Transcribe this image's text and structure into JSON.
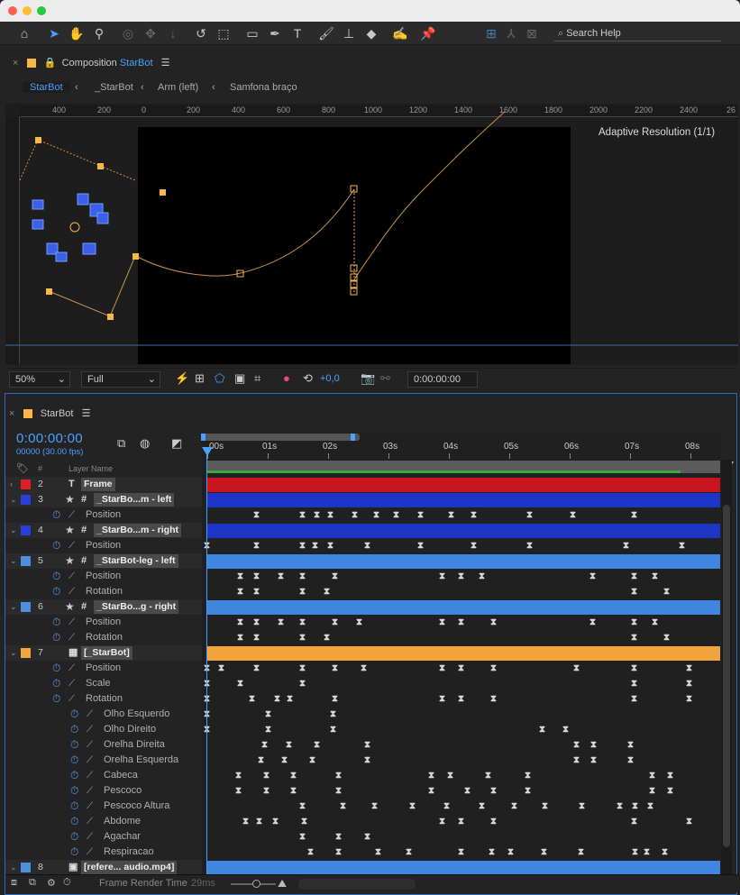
{
  "toolbar": {
    "search_placeholder": "Search Help",
    "tools": [
      "home-icon",
      "selection-icon",
      "hand-icon",
      "zoom-icon",
      "orbit-icon",
      "pan-icon",
      "dolly-icon",
      "rotate-icon",
      "region-icon",
      "rectangle-icon",
      "pen-icon",
      "type-icon",
      "brush-icon",
      "clone-icon",
      "eraser-icon",
      "roto-icon",
      "puppet-icon"
    ]
  },
  "composition_panel": {
    "tab_prefix": "Composition",
    "comp_name": "StarBot",
    "breadcrumbs": [
      "StarBot",
      "_StarBot",
      "Arm (left)",
      "Samfona braço"
    ],
    "ruler_labels": [
      "400",
      "200",
      "0",
      "200",
      "400",
      "600",
      "800",
      "1000",
      "1200",
      "1400",
      "1600",
      "1800",
      "2000",
      "2200",
      "2400",
      "26"
    ],
    "adaptive_resolution": "Adaptive Resolution (1/1)",
    "zoom": "50%",
    "resolution": "Full",
    "exposure": "+0,0",
    "current_time": "0:00:00:00"
  },
  "timeline": {
    "comp_name": "StarBot",
    "timecode": "0:00:00:00",
    "frame_info": "00000 (30.00 fps)",
    "layer_name_header": "Layer Name",
    "hash_header": "#",
    "time_ticks": [
      "00s",
      "01s",
      "02s",
      "03s",
      "04s",
      "05s",
      "06s",
      "07s",
      "08s"
    ],
    "frame_render_time_label": "Frame Render Time",
    "frame_render_time_value": "29ms",
    "rows": [
      {
        "kind": "layer",
        "num": "2",
        "type": "T",
        "name": "Frame",
        "label_color": "#e02020",
        "bar_color": "#c8141c",
        "kf": []
      },
      {
        "kind": "layer",
        "num": "3",
        "type": "#",
        "name": "_StarBo...m - left",
        "label_color": "#2a3ed8",
        "bar_color": "#1e36c8",
        "kf": []
      },
      {
        "kind": "prop",
        "name": "Position",
        "icon": "graph",
        "indent": 1,
        "kf": [
          285,
          336,
          352,
          367,
          394,
          418,
          440,
          467,
          501,
          526,
          588,
          636,
          704
        ]
      },
      {
        "kind": "layer",
        "num": "4",
        "type": "#",
        "name": "_StarBo...m - right",
        "label_color": "#2a3ed8",
        "bar_color": "#1e36c8",
        "kf": []
      },
      {
        "kind": "prop",
        "name": "Position",
        "icon": "graph",
        "indent": 1,
        "kf": [
          230,
          285,
          336,
          350,
          367,
          408,
          467,
          526,
          588,
          695,
          757
        ]
      },
      {
        "kind": "layer",
        "num": "5",
        "type": "#",
        "name": "_StarBot-leg - left",
        "label_color": "#4c90e0",
        "bar_color": "#3f86e0",
        "kf": []
      },
      {
        "kind": "prop",
        "name": "Position",
        "icon": "graph",
        "indent": 1,
        "kf": [
          267,
          285,
          312,
          336,
          372,
          491,
          512,
          535,
          658,
          704,
          727
        ]
      },
      {
        "kind": "prop",
        "name": "Rotation",
        "icon": "graph",
        "indent": 1,
        "kf": [
          267,
          285,
          336,
          363,
          704,
          740
        ]
      },
      {
        "kind": "layer",
        "num": "6",
        "type": "#",
        "name": "_StarBo...g - right",
        "label_color": "#4c90e0",
        "bar_color": "#3f86e0",
        "kf": []
      },
      {
        "kind": "prop",
        "name": "Position",
        "icon": "graph",
        "indent": 1,
        "kf": [
          267,
          285,
          312,
          336,
          372,
          399,
          491,
          512,
          548,
          658,
          704,
          727
        ]
      },
      {
        "kind": "prop",
        "name": "Rotation",
        "icon": "graph",
        "indent": 1,
        "kf": [
          267,
          285,
          336,
          363,
          704,
          740
        ]
      },
      {
        "kind": "layer",
        "num": "7",
        "type": "comp",
        "name": "[_StarBot]",
        "label_color": "#f0a83a",
        "bar_color": "#f2a43c",
        "kf": []
      },
      {
        "kind": "prop",
        "name": "Position",
        "icon": "graph",
        "indent": 1,
        "kf": [
          230,
          246,
          285,
          336,
          372,
          404,
          491,
          512,
          548,
          640,
          704,
          765
        ]
      },
      {
        "kind": "prop",
        "name": "Scale",
        "icon": "graph",
        "indent": 1,
        "kf": [
          230,
          267,
          336,
          704,
          765
        ]
      },
      {
        "kind": "prop",
        "name": "Rotation",
        "icon": "graph",
        "indent": 1,
        "kf": [
          230,
          280,
          308,
          322,
          372,
          491,
          512,
          548,
          704,
          765
        ]
      },
      {
        "kind": "prop",
        "name": "Olho Esquerdo",
        "icon": "graph",
        "indent": 2,
        "kf": [
          230,
          298,
          370
        ]
      },
      {
        "kind": "prop",
        "name": "Olho Direito",
        "icon": "graph",
        "indent": 2,
        "kf": [
          230,
          298,
          370,
          602,
          628
        ]
      },
      {
        "kind": "prop",
        "name": "Orelha Direita",
        "icon": "graph",
        "indent": 2,
        "kf": [
          294,
          321,
          352,
          408,
          640,
          659,
          700
        ]
      },
      {
        "kind": "prop",
        "name": "Orelha Esquerda",
        "icon": "graph",
        "indent": 2,
        "kf": [
          290,
          316,
          347,
          408,
          640,
          659,
          700
        ]
      },
      {
        "kind": "prop",
        "name": "Cabeca",
        "icon": "graph",
        "indent": 2,
        "kf": [
          265,
          296,
          326,
          376,
          479,
          500,
          542,
          586,
          724,
          744
        ]
      },
      {
        "kind": "prop",
        "name": "Pescoco",
        "icon": "graph",
        "indent": 2,
        "kf": [
          265,
          296,
          326,
          376,
          479,
          519,
          548,
          586,
          724,
          744
        ]
      },
      {
        "kind": "prop",
        "name": "Pescoco Altura",
        "icon": "graph",
        "indent": 2,
        "kf": [
          336,
          381,
          416,
          458,
          496,
          535,
          571,
          605,
          646,
          688,
          705,
          722
        ]
      },
      {
        "kind": "prop",
        "name": "Abdome",
        "icon": "graph",
        "indent": 2,
        "kf": [
          273,
          288,
          306,
          338,
          491,
          512,
          548,
          704,
          765
        ]
      },
      {
        "kind": "prop",
        "name": "Agachar",
        "icon": "graph",
        "indent": 2,
        "kf": [
          336,
          376,
          408
        ]
      },
      {
        "kind": "prop",
        "name": "Respiracao",
        "icon": "graph",
        "indent": 2,
        "kf": [
          345,
          376,
          420,
          454,
          512,
          546,
          567,
          604,
          645,
          705,
          718,
          738
        ]
      },
      {
        "kind": "layer",
        "num": "8",
        "type": "footage",
        "name": "[refere... audio.mp4]",
        "label_color": "#4c90e0",
        "bar_color": "#3f86e0",
        "kf": []
      }
    ]
  }
}
